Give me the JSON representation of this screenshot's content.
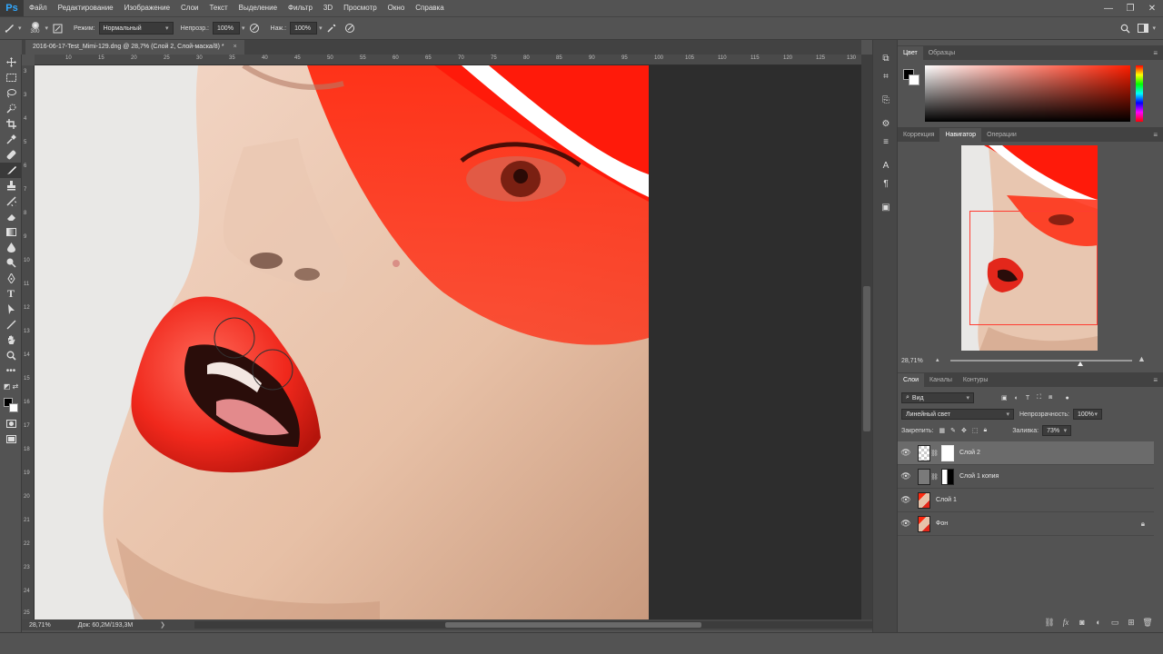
{
  "app": {
    "logo": "Ps"
  },
  "menu": [
    "Файл",
    "Редактирование",
    "Изображение",
    "Слои",
    "Текст",
    "Выделение",
    "Фильтр",
    "3D",
    "Просмотр",
    "Окно",
    "Справка"
  ],
  "window_controls": {
    "minimize": "—",
    "restore": "❐",
    "close": "✕"
  },
  "options": {
    "brush_size": "300",
    "mode_label": "Режим:",
    "mode_value": "Нормальный",
    "opacity_label": "Непрозр.:",
    "opacity_value": "100%",
    "flow_label": "Наж.:",
    "flow_value": "100%"
  },
  "document": {
    "tab_title": "2016-06-17-Test_Mimi-129.dng @ 28,7% (Слой 2, Слой-маска/8) *",
    "tab_close": "×"
  },
  "rulers": {
    "horizontal": [
      "10",
      "15",
      "20",
      "25",
      "30",
      "35",
      "40",
      "45",
      "50",
      "55",
      "60",
      "65",
      "70",
      "75",
      "80",
      "85",
      "90",
      "95",
      "100",
      "105",
      "110",
      "115",
      "120",
      "125",
      "130"
    ],
    "vertical": [
      "3",
      "3",
      "4",
      "5",
      "6",
      "7",
      "8",
      "9",
      "10",
      "11",
      "12",
      "13",
      "14",
      "15",
      "16",
      "17",
      "18",
      "19",
      "20",
      "21",
      "22",
      "23",
      "24",
      "25"
    ]
  },
  "status": {
    "zoom": "28,71%",
    "doc_info": "Док: 60,2M/193,3M",
    "arrow": "❯"
  },
  "color_panel": {
    "tabs": [
      "Цвет",
      "Образцы"
    ],
    "active": 0
  },
  "navigator_panel": {
    "tabs": [
      "Коррекция",
      "Навигатор",
      "Операции"
    ],
    "active": 1,
    "zoom": "28,71%"
  },
  "layers_panel": {
    "tabs": [
      "Слои",
      "Каналы",
      "Контуры"
    ],
    "active": 0,
    "filter_kind": "Вид",
    "blend_mode": "Линейный свет",
    "opacity_label": "Непрозрачность:",
    "opacity_value": "100%",
    "lock_label": "Закрепить:",
    "fill_label": "Заливка:",
    "fill_value": "73%",
    "layers": [
      {
        "name": "Слой 2",
        "selected": true,
        "locked": false
      },
      {
        "name": "Слой 1 копия",
        "selected": false,
        "locked": false
      },
      {
        "name": "Слой 1",
        "selected": false,
        "locked": false
      },
      {
        "name": "Фон",
        "selected": false,
        "locked": true
      }
    ],
    "footer_icons": [
      "link-icon",
      "fx-icon",
      "mask-icon",
      "adjustment-icon",
      "group-icon",
      "new-layer-icon",
      "trash-icon"
    ]
  },
  "tools": [
    "move-icon",
    "marquee-icon",
    "lasso-icon",
    "quick-select-icon",
    "crop-icon",
    "eyedropper-icon",
    "healing-icon",
    "brush-icon",
    "stamp-icon",
    "history-brush-icon",
    "eraser-icon",
    "gradient-icon",
    "blur-icon",
    "dodge-icon",
    "pen-icon",
    "type-icon",
    "path-select-icon",
    "line-icon",
    "hand-icon",
    "zoom-icon",
    "more-icon"
  ],
  "colors": {
    "accent": "#31a8ff",
    "nav_view": "#ff3b30",
    "foreground": "#000000",
    "background": "#ffffff"
  }
}
